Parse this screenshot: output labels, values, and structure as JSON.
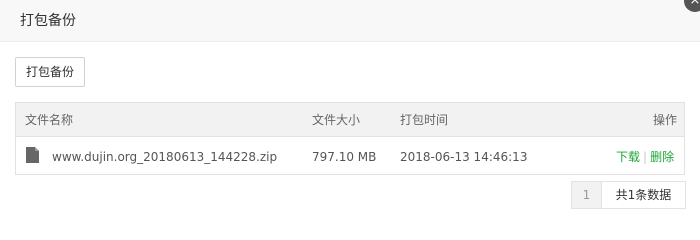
{
  "dialog": {
    "title": "打包备份",
    "close_icon": "×"
  },
  "toolbar": {
    "backup_label": "打包备份"
  },
  "table": {
    "columns": {
      "name": "文件名称",
      "size": "文件大小",
      "time": "打包时间",
      "action": "操作"
    },
    "rows": [
      {
        "icon": "file-icon",
        "name": "www.dujin.org_20180613_144228.zip",
        "size": "797.10 MB",
        "time": "2018-06-13 14:46:13",
        "download": "下载",
        "separator": "|",
        "delete": "删除"
      }
    ]
  },
  "pagination": {
    "current_page": "1",
    "total_text": "共1条数据"
  },
  "colors": {
    "link": "#20a53a",
    "header_bg": "#f2f2f2"
  }
}
